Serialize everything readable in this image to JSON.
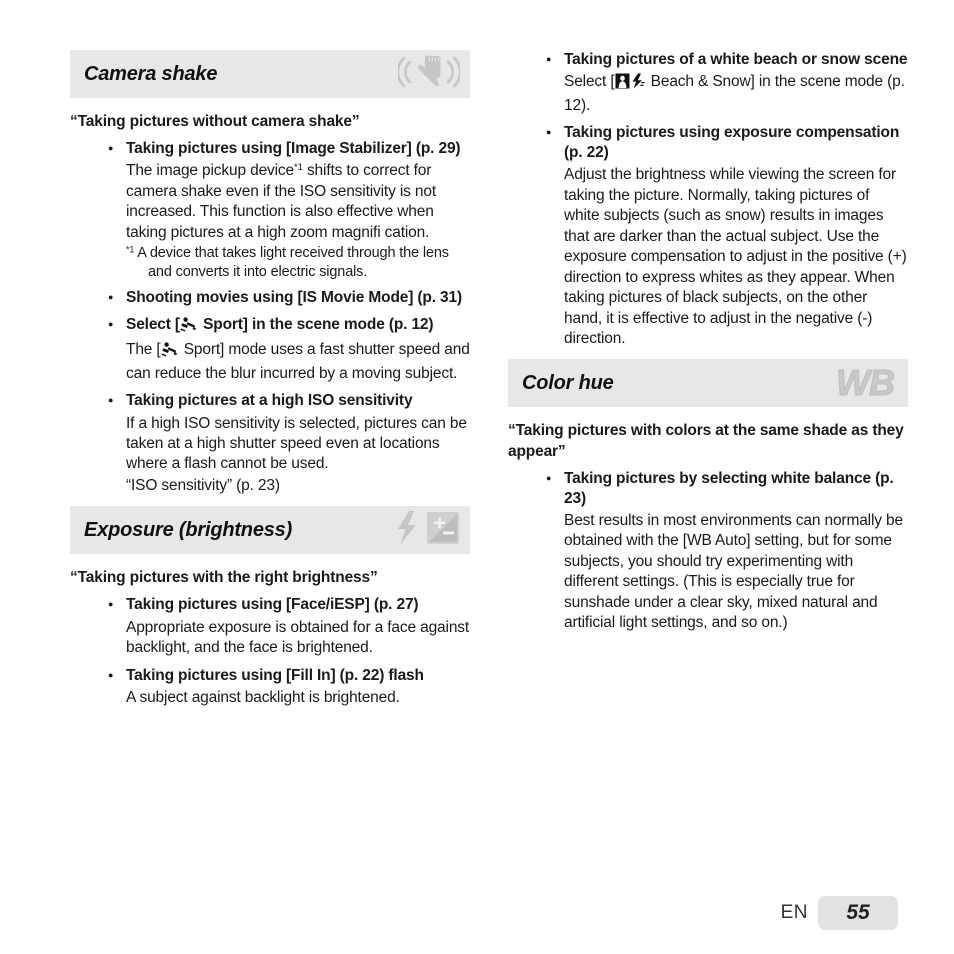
{
  "page": {
    "language_label": "EN",
    "page_number": "55",
    "band_color": "#e7e7e7",
    "text_color": "#1a1a1a"
  },
  "left_column": {
    "sections": [
      {
        "title": "Camera shake",
        "icons": [
          "camera-shake-hand-icon"
        ],
        "quote_heading": "“Taking pictures without camera shake”",
        "items": [
          {
            "bullet": "Taking pictures using [Image Stabilizer] (p. 29)",
            "body": "The image pickup device*1 shifts to correct for camera shake even if the ISO sensitivity is not increased. This function is also effective when taking pictures at a high zoom magnifi cation.",
            "body_pre_sup": "The image pickup device",
            "sup": "*1",
            "body_post_sup": " shifts to correct for camera shake even if the ISO sensitivity is not increased. This function is also effective when taking pictures at a high zoom magnifi cation.",
            "footnote_marker": "*1",
            "footnote": "A device that takes light received through the lens and converts it into electric signals."
          },
          {
            "bullet": "Shooting movies using [IS Movie Mode] (p. 31)",
            "body": ""
          },
          {
            "bullet_pre_icon": "Select [",
            "bullet_icon": "sport-scene-icon",
            "bullet_post_icon": " Sport] in the scene mode (p. 12)",
            "body_pre_icon": "The [",
            "body_icon": "sport-scene-icon",
            "body_post_icon": " Sport] mode uses a fast shutter speed and can reduce the blur incurred by a moving subject."
          },
          {
            "bullet": "Taking pictures at a high ISO sensitivity",
            "body": "If a high ISO sensitivity is selected, pictures can be taken at a high shutter speed even at locations where a flash cannot be used.",
            "body_extra": "“ISO sensitivity” (p. 23)"
          }
        ]
      },
      {
        "title": "Exposure (brightness)",
        "icons": [
          "flash-bolt-icon",
          "exposure-compensation-icon"
        ],
        "quote_heading": "“Taking pictures with the right brightness”",
        "items": [
          {
            "bullet": "Taking pictures using [Face/iESP] (p. 27)",
            "body": "Appropriate exposure is obtained for a face against backlight, and the face is brightened."
          },
          {
            "bullet": "Taking pictures using [Fill In] (p. 22) flash",
            "body": "A subject against backlight is brightened."
          }
        ]
      }
    ]
  },
  "right_column": {
    "top_items": [
      {
        "bullet": "Taking pictures of a white beach or snow scene",
        "body_pre_icon": "Select [",
        "body_icon": "beach-and-snow-scene-icon",
        "body_post_icon": " Beach & Snow] in the scene mode (p. 12)."
      },
      {
        "bullet": "Taking pictures using exposure compensation (p. 22)",
        "body": "Adjust the brightness while viewing the screen for taking the picture. Normally, taking pictures of white subjects (such as snow) results in images that are darker than the actual subject. Use the exposure compensation to adjust in the positive (+) direction to express whites as they appear. When taking pictures of black subjects, on the other hand, it is effective to adjust in the negative (-) direction."
      }
    ],
    "sections": [
      {
        "title": "Color hue",
        "icons": [
          "white-balance-wb-icon"
        ],
        "icon_text": "WB",
        "quote_heading": "“Taking pictures with colors at the same shade as they appear”",
        "items": [
          {
            "bullet": "Taking pictures by selecting white balance (p. 23)",
            "body": "Best results in most environments can normally be obtained with the [WB Auto] setting, but for some subjects, you should try experimenting with different settings. (This is especially true for sunshade under a clear sky, mixed natural and artificial light settings, and so on.)"
          }
        ]
      }
    ]
  }
}
